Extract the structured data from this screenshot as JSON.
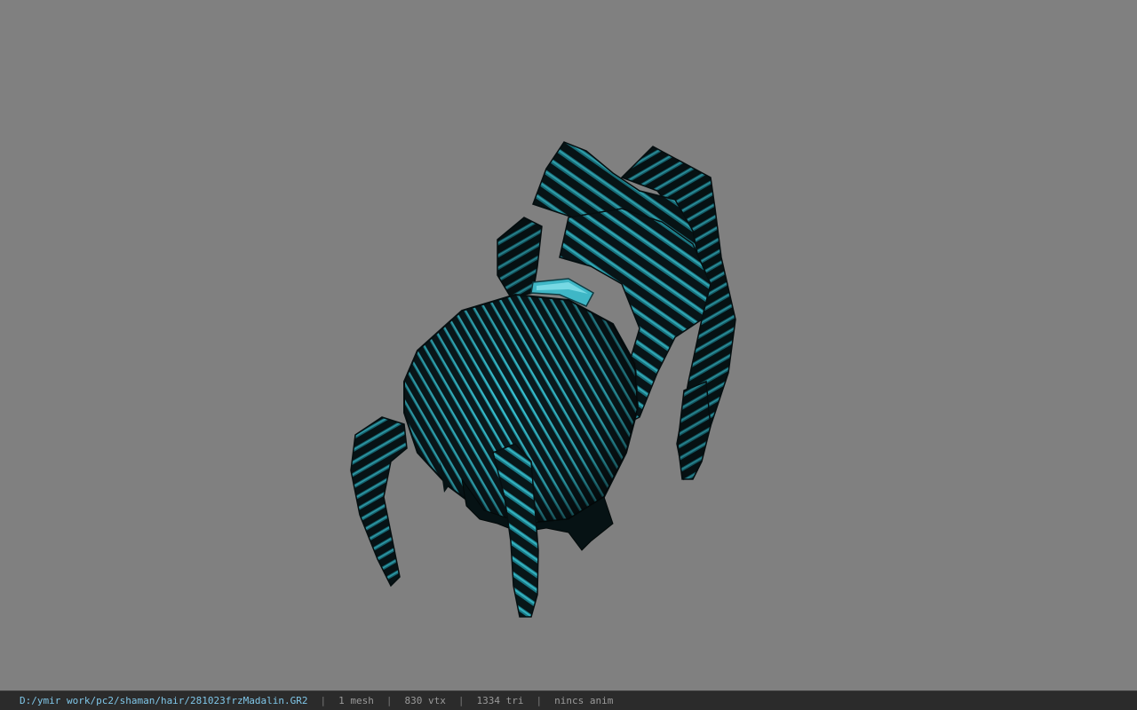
{
  "viewport": {
    "background_color": "#808080",
    "model": {
      "name": "hair-model",
      "base_color": "#0b1e22",
      "highlight_color": "#22b7c9",
      "band_color": "#46c7d6"
    }
  },
  "status_bar": {
    "file_path": "D:/ymir work/pc2/shaman/hair/281023frzMadalin.GR2",
    "separator": "|",
    "mesh_count": "1 mesh",
    "vertex_count": "830 vtx",
    "triangle_count": "1334 tri",
    "animation": "nincs anim"
  }
}
